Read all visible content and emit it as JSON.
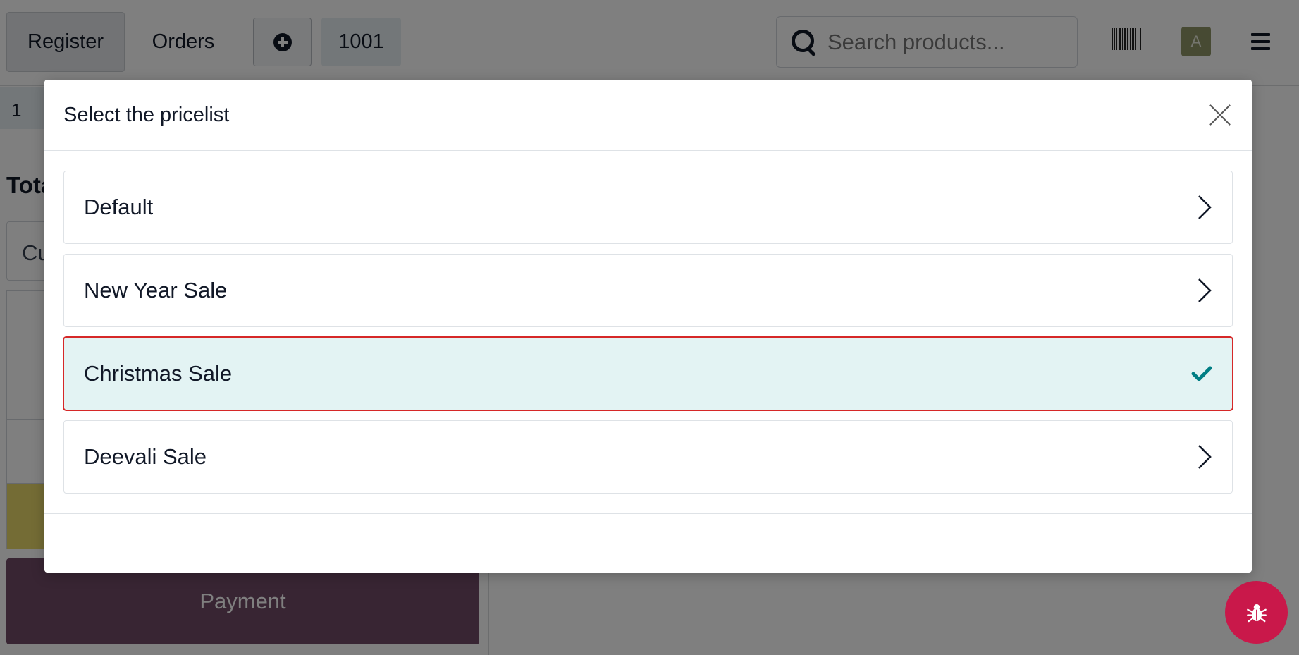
{
  "topbar": {
    "register_label": "Register",
    "orders_label": "Orders",
    "order_number": "1001",
    "search_placeholder": "Search products...",
    "avatar_letter": "A"
  },
  "left_pane": {
    "line_quantity": "1",
    "total_label": "Total",
    "customer_label": "Cu",
    "payment_label": "Payment"
  },
  "modal": {
    "title": "Select the pricelist",
    "items": [
      {
        "label": "Default",
        "selected": false
      },
      {
        "label": "New Year Sale",
        "selected": false
      },
      {
        "label": "Christmas Sale",
        "selected": true
      },
      {
        "label": "Deevali Sale",
        "selected": false
      }
    ]
  },
  "colors": {
    "accent": "#714b67",
    "selected_bg": "#e3f3f3",
    "selected_outline": "#d62828",
    "check": "#017e84",
    "debug_fab": "#c9184a"
  },
  "icons": [
    "plus-circle-icon",
    "search-icon",
    "barcode-icon",
    "menu-icon",
    "close-icon",
    "chevron-right-icon",
    "check-icon",
    "bug-icon"
  ]
}
